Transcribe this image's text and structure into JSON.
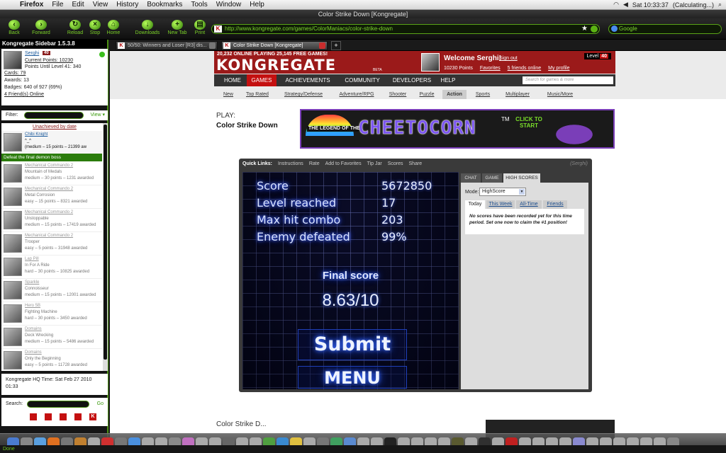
{
  "menubar": {
    "app": "Firefox",
    "items": [
      "File",
      "Edit",
      "View",
      "History",
      "Bookmarks",
      "Tools",
      "Window",
      "Help"
    ],
    "clock": "Sat 10:33:37",
    "status": "(Calculating...)"
  },
  "window_title": "Color Strike Down [Kongregate]",
  "toolbar": {
    "back": "Back",
    "forward": "Forward",
    "reload": "Reload",
    "stop": "Stop",
    "home": "Home",
    "downloads": "Downloads",
    "newtab": "New Tab",
    "print": "Print",
    "url": "http://www.kongregate.com/games/ColorManiacs/color-strike-down",
    "search_placeholder": "Google"
  },
  "browser_tabs": [
    {
      "title": "50/50: Winners and Loser [R3] dis..."
    },
    {
      "title": "Color Strike Down [Kongregate]"
    }
  ],
  "sidebar": {
    "title": "Kongregate Sidebar 1.5.3.8",
    "username": "Serghi",
    "level": "40",
    "current_points": "Current Points: 10230",
    "points_until": "Points Until Level 41: 340",
    "cards": "Cards: 79",
    "awards": "Awards: 13",
    "badges": "Badges: 640 of 927 (69%)",
    "friends_online": "4 Friend(s) Online",
    "filter_label": "Filter:",
    "view_label": "View ▾",
    "unachieved": "Unachieved by date",
    "active_badge": {
      "name": "Chibi Knight",
      "line2": "^_^",
      "line3": "(medium – 15 points – 21399 aw",
      "desc": "Defeat the final demon boss"
    },
    "badges_list": [
      {
        "name": "Mechanical Commando 2",
        "line2": "Mountain of Medals",
        "line3": "medium – 30 points – 1231 awarded"
      },
      {
        "name": "Mechanical Commando 2",
        "line2": "Metal Corrosion",
        "line3": "easy – 15 points – 8321 awarded"
      },
      {
        "name": "Mechanical Commando 2",
        "line2": "Unstoppable",
        "line3": "medium – 15 points – 17419 awarded"
      },
      {
        "name": "Mechanical Commando 2",
        "line2": "Trooper",
        "line3": "easy – 5 points – 31948 awarded"
      },
      {
        "name": "Lap Pill",
        "line2": "In For A Ride",
        "line3": "hard – 30 points – 10825 awarded"
      },
      {
        "name": "Sparkle",
        "line2": "Connoisseur",
        "line3": "medium – 15 points – 12001 awarded"
      },
      {
        "name": "Hero 5B",
        "line2": "Fighting Machine",
        "line3": "hard – 30 points – 3450 awarded"
      },
      {
        "name": "Domains",
        "line2": "Deck Wrecking",
        "line3": "medium – 15 points – 5486 awarded"
      },
      {
        "name": "Domains",
        "line2": "Only the Beginning",
        "line3": "easy – 5 points – 11728 awarded"
      }
    ],
    "hq_time": "Kongregate HQ Time: Sat Feb 27 2010 01:33",
    "search_label": "Search:",
    "search_go": "Go"
  },
  "kong": {
    "stats": "20,232 ONLINE PLAYING 25,145 FREE GAMES!",
    "logo": "KONGREGATE",
    "beta": "BETA",
    "welcome": "Welcome Serghi!",
    "signout": "Sign out",
    "points": "10230 Points",
    "favorites": "Favorites",
    "friends": "5 friends online",
    "profile": "My profile",
    "level_label": "Level",
    "level": "40",
    "nav": [
      "HOME",
      "GAMES",
      "ACHIEVEMENTS",
      "COMMUNITY",
      "DEVELOPERS",
      "HELP"
    ],
    "search_placeholder": "Search for games & more",
    "subnav": [
      "New",
      "Top Rated",
      "Strategy/Defense",
      "Adventure/RPG",
      "Shooter",
      "Puzzle",
      "Action",
      "Sports",
      "Multiplayer",
      "Music/More"
    ]
  },
  "play_label": "PLAY:",
  "game_title": "Color Strike Down",
  "banner": {
    "legend": "THE LEGEND OF THE",
    "title": "CHEETOCORN",
    "tm": "TM",
    "cta": "CLICK TO START"
  },
  "quicklinks": {
    "label": "Quick Links:",
    "items": [
      "Instructions",
      "Rate",
      "Add to Favorites",
      "Tip Jar",
      "Scores",
      "Share"
    ],
    "user": "(Serghi)"
  },
  "game": {
    "stats": [
      {
        "label": "Score",
        "value": "5672850"
      },
      {
        "label": "Level reached",
        "value": "17"
      },
      {
        "label": "Max hit combo",
        "value": "203"
      },
      {
        "label": "Enemy defeated",
        "value": "99%"
      }
    ],
    "final_label": "Final score",
    "final_value": "8.63/10",
    "submit": "Submit",
    "menu": "MENU"
  },
  "panel": {
    "tabs": [
      "CHAT",
      "GAME",
      "HIGH SCORES"
    ],
    "mode_label": "Mode:",
    "mode_value": "HighScore",
    "score_tabs": [
      "Today",
      "This Week",
      "All-Time",
      "Friends"
    ],
    "no_scores": "No scores have been recorded yet for this time period. Set one now to claim the #1 position!"
  },
  "below_title": "Color Strike D...",
  "statusbar": "Done",
  "colors": {
    "kong_red": "#9b1a1a",
    "accent_green": "#7bd128"
  }
}
